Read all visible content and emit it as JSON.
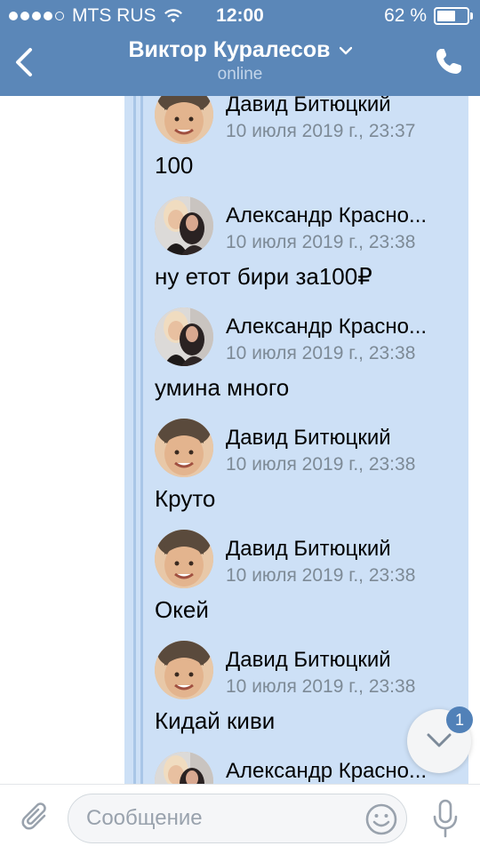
{
  "status_bar": {
    "carrier": "MTS RUS",
    "time": "12:00",
    "battery": "62 %",
    "battery_level": 0.62
  },
  "header": {
    "title": "Виктор Куралесов",
    "subtitle": "online"
  },
  "messages": [
    {
      "name": "Давид Битюцкий",
      "date": "10 июля 2019 г., 23:37",
      "text": "100",
      "avatar": "boy"
    },
    {
      "name": "Александр Красно...",
      "date": "10 июля 2019 г., 23:38",
      "text": "ну етот бири за100₽",
      "avatar": "girl"
    },
    {
      "name": "Александр Красно...",
      "date": "10 июля 2019 г., 23:38",
      "text": "умина много",
      "avatar": "girl"
    },
    {
      "name": "Давид Битюцкий",
      "date": "10 июля 2019 г., 23:38",
      "text": "Круто",
      "avatar": "boy"
    },
    {
      "name": "Давид Битюцкий",
      "date": "10 июля 2019 г., 23:38",
      "text": "Окей",
      "avatar": "boy"
    },
    {
      "name": "Давид Битюцкий",
      "date": "10 июля 2019 г., 23:38",
      "text": "Кидай киви",
      "avatar": "boy"
    },
    {
      "name": "Александр Красно...",
      "date": "10 июля 2019 г., 23:38",
      "text": "",
      "avatar": "girl"
    }
  ],
  "scroll_badge": "1",
  "composer": {
    "placeholder": "Сообщение"
  },
  "colors": {
    "header": "#5b87b8",
    "forward_bg": "#cde0f6",
    "accent": "#5181b8"
  }
}
